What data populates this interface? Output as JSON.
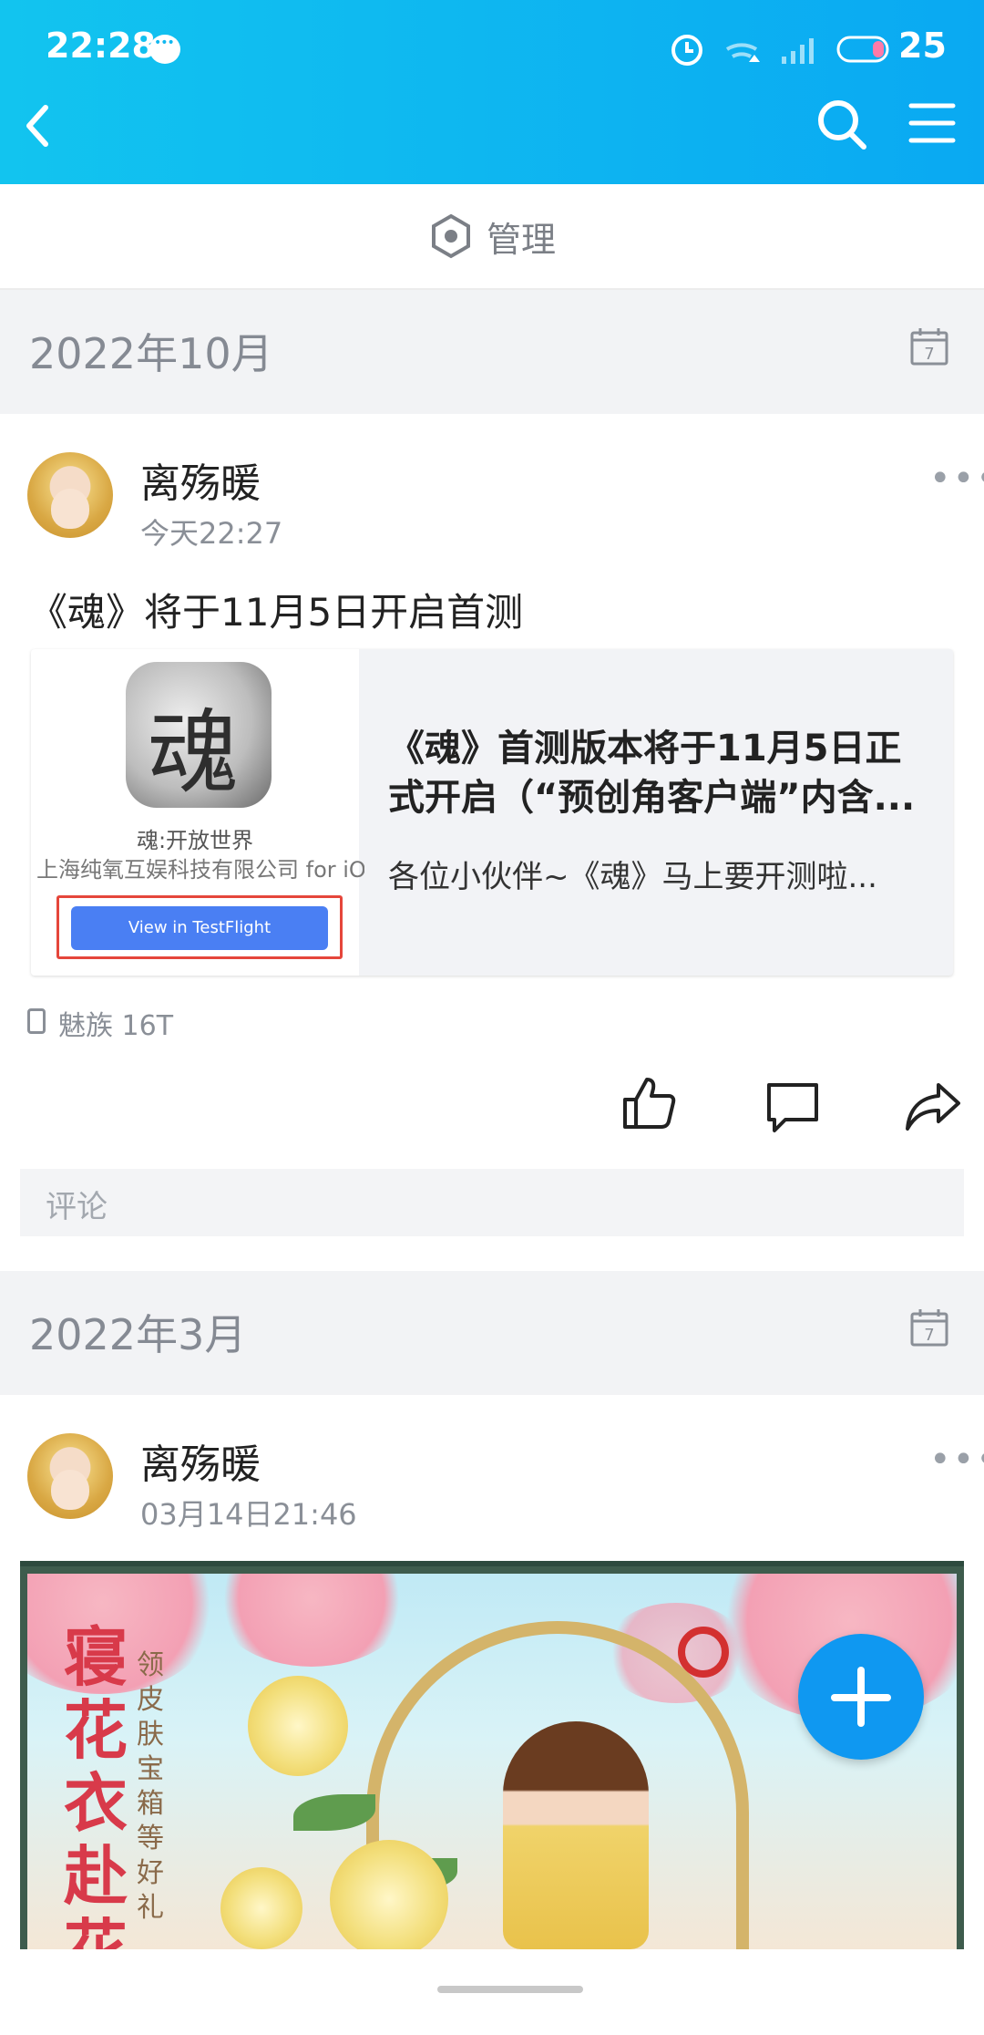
{
  "status_bar": {
    "time": "22:28",
    "battery": "25"
  },
  "toolbar": {
    "back_icon": "back-arrow-icon",
    "search_icon": "search-icon",
    "menu_icon": "menu-icon"
  },
  "manage": {
    "label": "管理"
  },
  "sections": [
    {
      "month": "2022年10月"
    },
    {
      "month": "2022年3月"
    }
  ],
  "post1": {
    "author": "离殇暖",
    "time": "今天22:27",
    "text": "《魂》将于11月5日开启首测",
    "link": {
      "app_name": "魂:开放世界",
      "developer": "上海纯氧互娱科技有限公司 for iOS",
      "button": "View in TestFlight",
      "title": "《魂》首测版本将于11月5日正式开启（“预创角客户端”内含...",
      "desc": "各位小伙伴~《魂》马上要开测啦..."
    },
    "device": "魅族 16T",
    "comment_placeholder": "评论"
  },
  "post2": {
    "author": "离殇暖",
    "time": "03月14日21:46",
    "image_text_main": "寝花衣赴花",
    "image_text_side": "领皮肤宝箱等好礼"
  }
}
